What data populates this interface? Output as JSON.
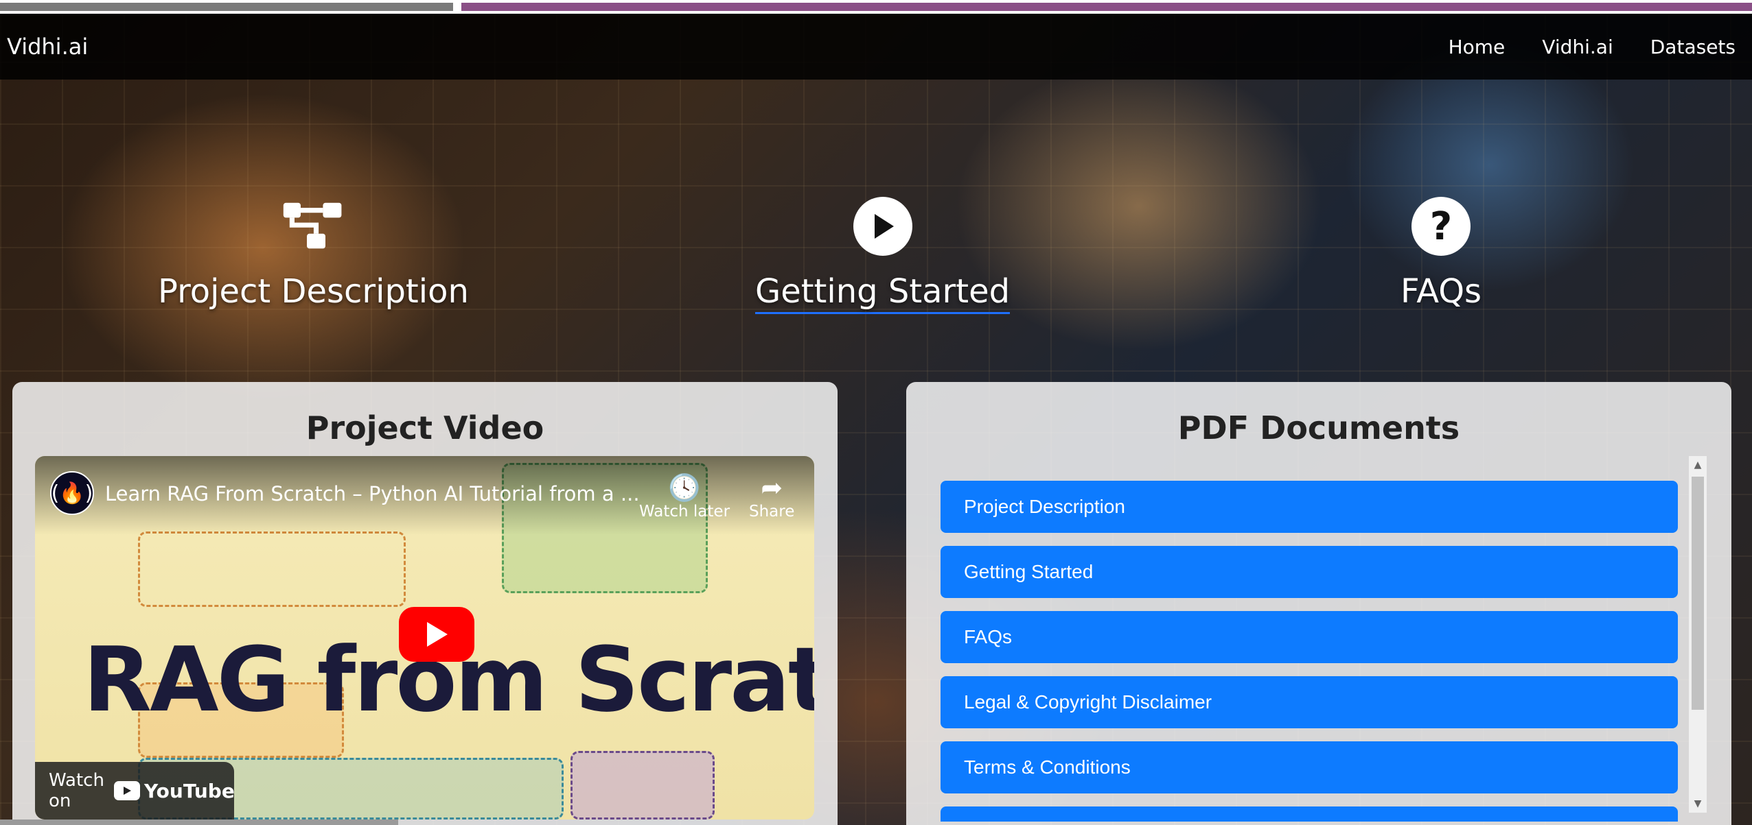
{
  "navbar": {
    "brand": "Vidhi.ai",
    "links": [
      "Home",
      "Vidhi.ai",
      "Datasets"
    ]
  },
  "features": [
    {
      "label": "Project Description",
      "icon": "sitemap-icon"
    },
    {
      "label": "Getting Started",
      "icon": "play-circle-icon"
    },
    {
      "label": "FAQs",
      "icon": "question-circle-icon"
    }
  ],
  "video_card": {
    "title": "Project Video",
    "video": {
      "title": "Learn RAG From Scratch – Python AI Tutorial from a ...",
      "watch_later": "Watch later",
      "share": "Share",
      "thumbnail_text": "RAG from Scratch",
      "watch_on": "Watch on",
      "youtube": "YouTube"
    }
  },
  "pdf_card": {
    "title": "PDF Documents",
    "items": [
      "Project Description",
      "Getting Started",
      "FAQs",
      "Legal & Copyright Disclaimer",
      "Terms & Conditions"
    ]
  },
  "colors": {
    "accent": "#0d7bff",
    "strip_left": "#7a7a7a",
    "strip_right": "#8a4f86"
  }
}
